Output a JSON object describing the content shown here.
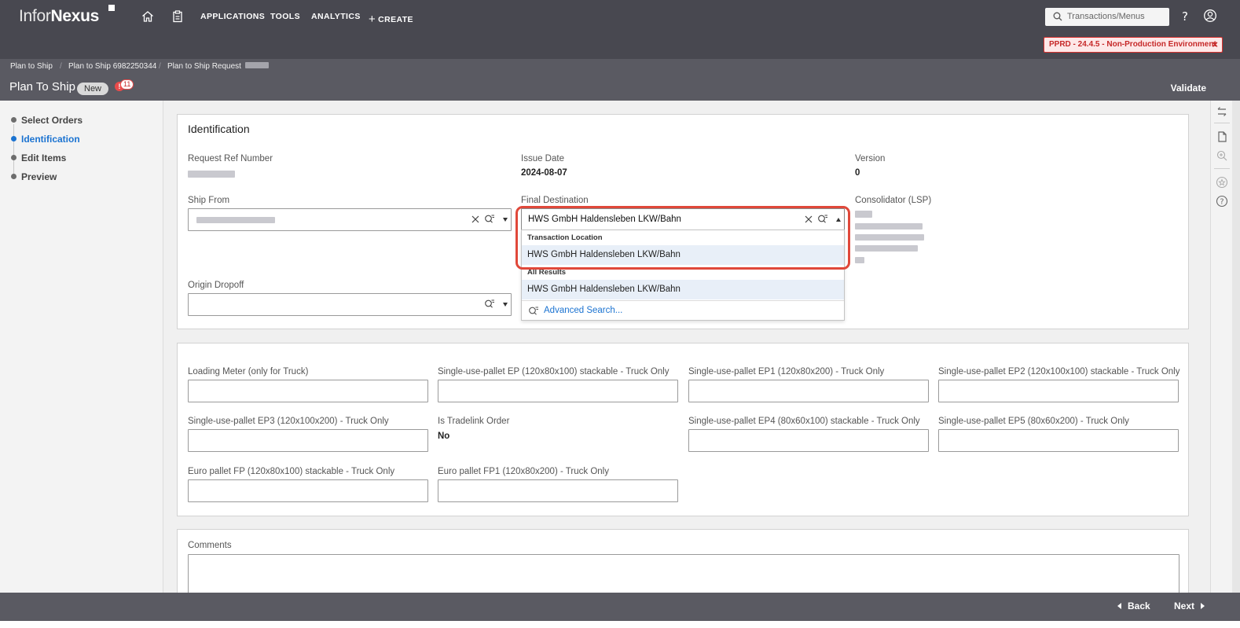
{
  "app": {
    "logo_light": "Infor",
    "logo_bold": "Nexus",
    "nav": [
      "APPLICATIONS",
      "TOOLS",
      "ANALYTICS",
      "CREATE"
    ],
    "search_placeholder": "Transactions/Menus",
    "env_banner": "PPRD - 24.4.5 - Non-Production Environment"
  },
  "breadcrumb": [
    "Plan to Ship",
    "Plan to Ship 6982250344",
    "Plan to Ship Request"
  ],
  "header": {
    "title": "Plan To Ship",
    "status": "New",
    "alert_count": "11",
    "validate_label": "Validate"
  },
  "steps": [
    {
      "label": "Select Orders",
      "active": false
    },
    {
      "label": "Identification",
      "active": true
    },
    {
      "label": "Edit Items",
      "active": false
    },
    {
      "label": "Preview",
      "active": false
    }
  ],
  "identification": {
    "title": "Identification",
    "request_ref_label": "Request Ref Number",
    "issue_date_label": "Issue Date",
    "issue_date": "2024-08-07",
    "version_label": "Version",
    "version": "0",
    "ship_from_label": "Ship From",
    "final_destination_label": "Final Destination",
    "final_destination_value": "HWS GmbH Haldensleben LKW/Bahn",
    "consolidator_label": "Consolidator (LSP)",
    "origin_dropoff_label": "Origin Dropoff"
  },
  "dropdown": {
    "group1": "Transaction Location",
    "group1_item": "HWS GmbH Haldensleben LKW/Bahn",
    "group2": "All Results",
    "group2_item": "HWS GmbH Haldensleben LKW/Bahn",
    "advanced": "Advanced Search..."
  },
  "pallets": {
    "loading_meter": "Loading Meter (only for Truck)",
    "ep": "Single-use-pallet EP (120x80x100) stackable - Truck Only",
    "ep1": "Single-use-pallet EP1 (120x80x200) - Truck Only",
    "ep2": "Single-use-pallet EP2 (120x100x100) stackable - Truck Only",
    "ep3": "Single-use-pallet EP3 (120x100x200) - Truck Only",
    "tradelink_label": "Is Tradelink Order",
    "tradelink_value": "No",
    "ep4": "Single-use-pallet EP4 (80x60x100) stackable - Truck Only",
    "ep5": "Single-use-pallet EP5 (80x60x200) - Truck Only",
    "fp": "Euro pallet FP (120x80x100) stackable - Truck Only",
    "fp1": "Euro pallet FP1 (120x80x200) - Truck Only"
  },
  "comments_label": "Comments",
  "footer": {
    "back": "Back",
    "next": "Next"
  },
  "colors": {
    "accent": "#1b73d1",
    "highlight": "#e0483a",
    "topbar": "#484850"
  }
}
